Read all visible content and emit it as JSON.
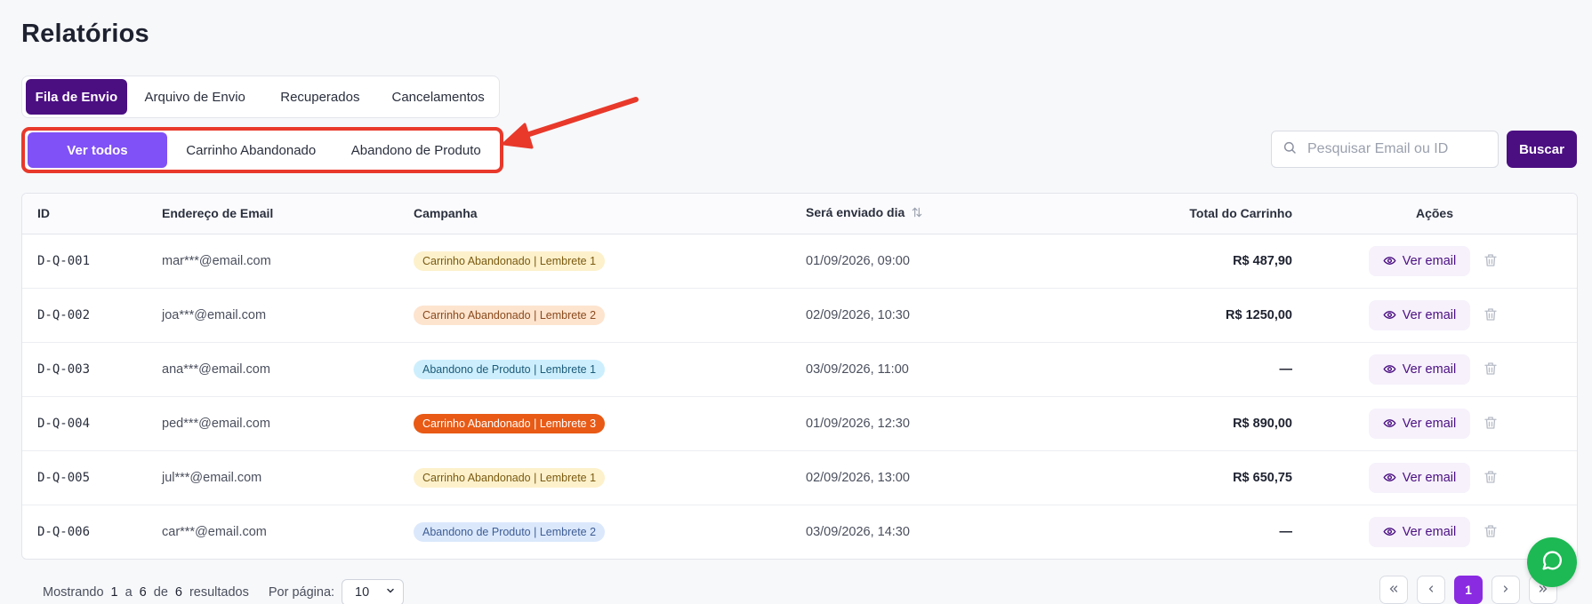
{
  "page": {
    "title": "Relatórios"
  },
  "primary_tabs": [
    {
      "label": "Fila de Envio",
      "active": true
    },
    {
      "label": "Arquivo de Envio",
      "active": false
    },
    {
      "label": "Recuperados",
      "active": false
    },
    {
      "label": "Cancelamentos",
      "active": false
    }
  ],
  "secondary_tabs": [
    {
      "label": "Ver todos",
      "active": true
    },
    {
      "label": "Carrinho Abandonado",
      "active": false
    },
    {
      "label": "Abandono de Produto",
      "active": false
    }
  ],
  "search": {
    "placeholder": "Pesquisar Email ou ID",
    "button_label": "Buscar"
  },
  "table": {
    "headers": {
      "id": "ID",
      "email": "Endereço de Email",
      "campaign": "Campanha",
      "send_date": "Será enviado dia",
      "cart_total": "Total do Carrinho",
      "actions": "Ações"
    },
    "view_label": "Ver email",
    "rows": [
      {
        "id": "D-Q-001",
        "email": "mar***@email.com",
        "campaign": "Carrinho Abandonado | Lembrete 1",
        "badge": "yellow",
        "date": "01/09/2026, 09:00",
        "total": "R$ 487,90"
      },
      {
        "id": "D-Q-002",
        "email": "joa***@email.com",
        "campaign": "Carrinho Abandonado | Lembrete 2",
        "badge": "peach",
        "date": "02/09/2026, 10:30",
        "total": "R$ 1250,00"
      },
      {
        "id": "D-Q-003",
        "email": "ana***@email.com",
        "campaign": "Abandono de Produto | Lembrete 1",
        "badge": "blue",
        "date": "03/09/2026, 11:00",
        "total": "—"
      },
      {
        "id": "D-Q-004",
        "email": "ped***@email.com",
        "campaign": "Carrinho Abandonado | Lembrete 3",
        "badge": "orange",
        "date": "01/09/2026, 12:30",
        "total": "R$ 890,00"
      },
      {
        "id": "D-Q-005",
        "email": "jul***@email.com",
        "campaign": "Carrinho Abandonado | Lembrete 1",
        "badge": "yellow",
        "date": "02/09/2026, 13:00",
        "total": "R$ 650,75"
      },
      {
        "id": "D-Q-006",
        "email": "car***@email.com",
        "campaign": "Abandono de Produto | Lembrete 2",
        "badge": "lav",
        "date": "03/09/2026, 14:30",
        "total": "—"
      }
    ]
  },
  "footer": {
    "showing_prefix": "Mostrando",
    "from": "1",
    "to_word": "a",
    "to": "6",
    "of_word": "de",
    "total": "6",
    "results_word": "resultados",
    "per_page_label": "Por página:",
    "per_page_value": "10"
  },
  "pagination": {
    "current_page": "1"
  },
  "icons": {
    "search": "search-icon",
    "sort": "sort-icon",
    "eye": "eye-icon",
    "trash": "trash-icon",
    "chevron_down": "chevron-down-icon",
    "first": "chevrons-left-icon",
    "prev": "chevron-left-icon",
    "next": "chevron-right-icon",
    "last": "chevrons-right-icon",
    "chat": "whatsapp-icon"
  },
  "colors": {
    "primary": "#4b0f82",
    "secondary_active": "#8051f6",
    "highlight_annotation": "#e8392b",
    "page_active": "#8a2be2",
    "chat_fab": "#1db954"
  }
}
